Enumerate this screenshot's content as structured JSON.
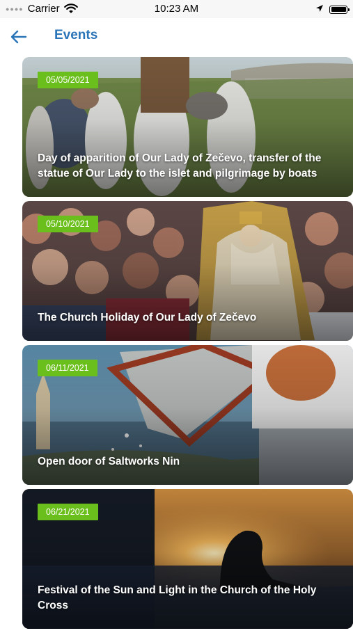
{
  "status": {
    "carrier": "Carrier",
    "time": "10:23 AM"
  },
  "nav": {
    "title": "Events"
  },
  "events": [
    {
      "date": "05/05/2021",
      "title": "Day of apparition of Our Lady of Zečevo, transfer of the statue of Our Lady to the islet and pilgrimage by boats"
    },
    {
      "date": "05/10/2021",
      "title": "The Church Holiday of Our Lady of Zečevo"
    },
    {
      "date": "06/11/2021",
      "title": "Open door of Saltworks Nin"
    },
    {
      "date": "06/21/2021",
      "title": "Festival of the Sun and Light in the Church of the Holy Cross"
    }
  ],
  "colors": {
    "accent": "#2a74b8",
    "badge": "#6bbf1c"
  }
}
